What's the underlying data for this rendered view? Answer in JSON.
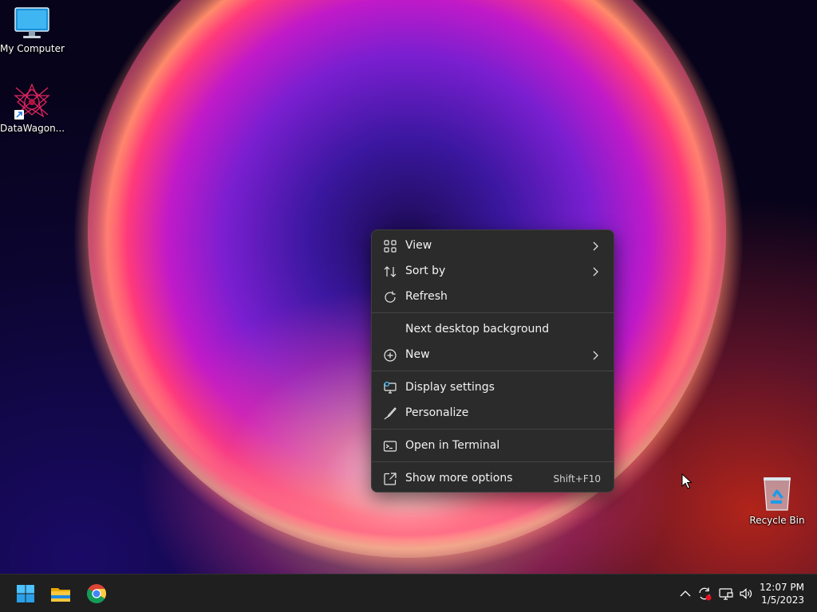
{
  "desktop": {
    "icons": [
      {
        "label": "My Computer",
        "icon": "monitor-icon"
      },
      {
        "label": "DataWagon...",
        "icon": "datawagon-app-icon"
      },
      {
        "label": "Recycle Bin",
        "icon": "recycle-bin-icon"
      }
    ]
  },
  "context_menu": {
    "items": [
      {
        "label": "View",
        "icon": "grid-icon",
        "submenu": true
      },
      {
        "label": "Sort by",
        "icon": "sort-icon",
        "submenu": true
      },
      {
        "label": "Refresh",
        "icon": "refresh-icon",
        "submenu": false
      },
      {
        "label": "Next desktop background",
        "icon": "",
        "submenu": false
      },
      {
        "label": "New",
        "icon": "plus-circle-icon",
        "submenu": true
      },
      {
        "label": "Display settings",
        "icon": "display-icon",
        "submenu": false
      },
      {
        "label": "Personalize",
        "icon": "brush-icon",
        "submenu": false
      },
      {
        "label": "Open in Terminal",
        "icon": "terminal-icon",
        "submenu": false
      },
      {
        "label": "Show more options",
        "icon": "external-icon",
        "submenu": false,
        "shortcut": "Shift+F10"
      }
    ]
  },
  "taskbar": {
    "apps": [
      {
        "icon": "windows-start-icon"
      },
      {
        "icon": "file-explorer-icon"
      },
      {
        "icon": "chrome-icon"
      }
    ],
    "tray": {
      "icons": [
        "chevron-up-icon",
        "sync-icon",
        "network-icon",
        "volume-icon"
      ],
      "time": "12:07 PM",
      "date": "1/5/2023"
    }
  },
  "colors": {
    "menu_bg": "#2b2b2b",
    "taskbar_bg": "#1f1f1f",
    "accent": "#4cc2ff"
  }
}
